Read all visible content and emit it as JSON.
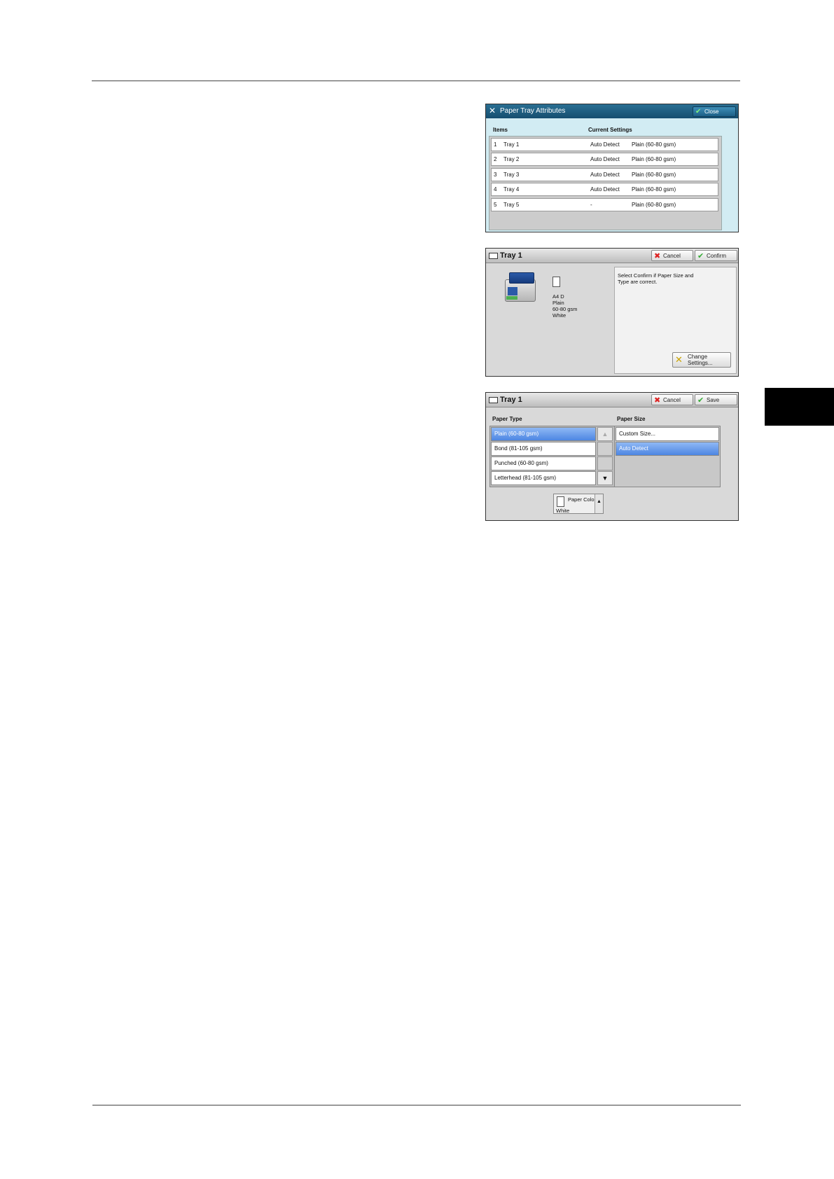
{
  "screen1": {
    "title": "Paper Tray Attributes",
    "close_label": "Close",
    "col_items": "Items",
    "col_settings": "Current Settings",
    "rows": [
      {
        "num": "1",
        "name": "Tray 1",
        "size": "Auto Detect",
        "type": "Plain (60-80 gsm)"
      },
      {
        "num": "2",
        "name": "Tray 2",
        "size": "Auto Detect",
        "type": "Plain (60-80 gsm)"
      },
      {
        "num": "3",
        "name": "Tray 3",
        "size": "Auto Detect",
        "type": "Plain (60-80 gsm)"
      },
      {
        "num": "4",
        "name": "Tray 4",
        "size": "Auto Detect",
        "type": "Plain (60-80 gsm)"
      },
      {
        "num": "5",
        "name": "Tray 5",
        "size": "-",
        "type": "Plain (60-80 gsm)"
      }
    ]
  },
  "screen2": {
    "title": "Tray 1",
    "cancel_label": "Cancel",
    "confirm_label": "Confirm",
    "paper_size": "A4 D",
    "paper_type": "Plain",
    "paper_weight": "60-80 gsm",
    "paper_color": "White",
    "info_text": "Select Confirm if Paper Size and Type are correct.",
    "change_line1": "Change",
    "change_line2": "Settings..."
  },
  "screen3": {
    "title": "Tray 1",
    "cancel_label": "Cancel",
    "save_label": "Save",
    "paper_type_label": "Paper Type",
    "paper_size_label": "Paper Size",
    "types": [
      "Plain (60-80 gsm)",
      "Bond (81-105 gsm)",
      "Punched (60-80 gsm)",
      "Letterhead (81-105 gsm)"
    ],
    "sizes": [
      "Custom Size...",
      "Auto Detect"
    ],
    "color_label": "Paper Color",
    "color_value": "White"
  },
  "icons": {
    "close": "check-icon",
    "cancel": "x-icon",
    "confirm": "check-icon",
    "save": "check-icon"
  },
  "colors": {
    "title_blue": "#1c5f86",
    "selected_blue": "#4d86e3",
    "screen1_bg": "#d2ecf3"
  }
}
